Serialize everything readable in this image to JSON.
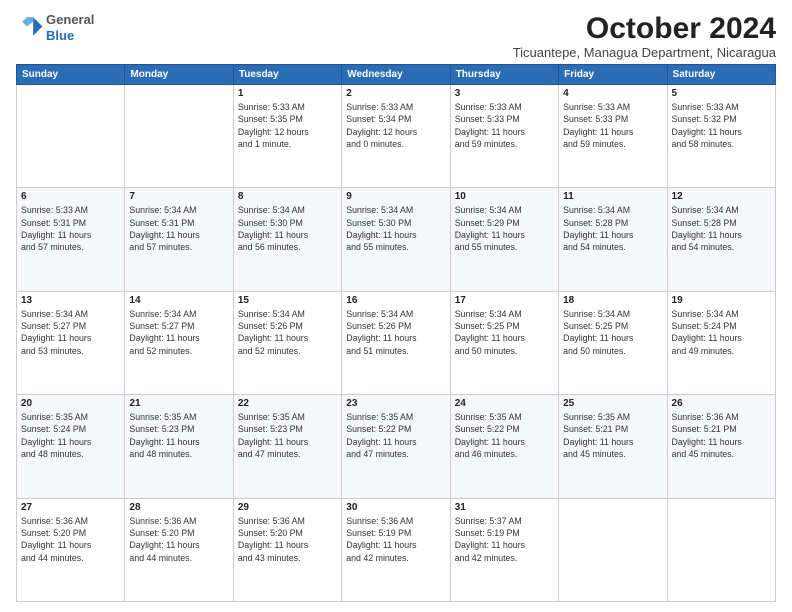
{
  "logo": {
    "general": "General",
    "blue": "Blue"
  },
  "header": {
    "month": "October 2024",
    "location": "Ticuantepe, Managua Department, Nicaragua"
  },
  "days_of_week": [
    "Sunday",
    "Monday",
    "Tuesday",
    "Wednesday",
    "Thursday",
    "Friday",
    "Saturday"
  ],
  "weeks": [
    [
      {
        "day": "",
        "info": ""
      },
      {
        "day": "",
        "info": ""
      },
      {
        "day": "1",
        "info": "Sunrise: 5:33 AM\nSunset: 5:35 PM\nDaylight: 12 hours\nand 1 minute."
      },
      {
        "day": "2",
        "info": "Sunrise: 5:33 AM\nSunset: 5:34 PM\nDaylight: 12 hours\nand 0 minutes."
      },
      {
        "day": "3",
        "info": "Sunrise: 5:33 AM\nSunset: 5:33 PM\nDaylight: 11 hours\nand 59 minutes."
      },
      {
        "day": "4",
        "info": "Sunrise: 5:33 AM\nSunset: 5:33 PM\nDaylight: 11 hours\nand 59 minutes."
      },
      {
        "day": "5",
        "info": "Sunrise: 5:33 AM\nSunset: 5:32 PM\nDaylight: 11 hours\nand 58 minutes."
      }
    ],
    [
      {
        "day": "6",
        "info": "Sunrise: 5:33 AM\nSunset: 5:31 PM\nDaylight: 11 hours\nand 57 minutes."
      },
      {
        "day": "7",
        "info": "Sunrise: 5:34 AM\nSunset: 5:31 PM\nDaylight: 11 hours\nand 57 minutes."
      },
      {
        "day": "8",
        "info": "Sunrise: 5:34 AM\nSunset: 5:30 PM\nDaylight: 11 hours\nand 56 minutes."
      },
      {
        "day": "9",
        "info": "Sunrise: 5:34 AM\nSunset: 5:30 PM\nDaylight: 11 hours\nand 55 minutes."
      },
      {
        "day": "10",
        "info": "Sunrise: 5:34 AM\nSunset: 5:29 PM\nDaylight: 11 hours\nand 55 minutes."
      },
      {
        "day": "11",
        "info": "Sunrise: 5:34 AM\nSunset: 5:28 PM\nDaylight: 11 hours\nand 54 minutes."
      },
      {
        "day": "12",
        "info": "Sunrise: 5:34 AM\nSunset: 5:28 PM\nDaylight: 11 hours\nand 54 minutes."
      }
    ],
    [
      {
        "day": "13",
        "info": "Sunrise: 5:34 AM\nSunset: 5:27 PM\nDaylight: 11 hours\nand 53 minutes."
      },
      {
        "day": "14",
        "info": "Sunrise: 5:34 AM\nSunset: 5:27 PM\nDaylight: 11 hours\nand 52 minutes."
      },
      {
        "day": "15",
        "info": "Sunrise: 5:34 AM\nSunset: 5:26 PM\nDaylight: 11 hours\nand 52 minutes."
      },
      {
        "day": "16",
        "info": "Sunrise: 5:34 AM\nSunset: 5:26 PM\nDaylight: 11 hours\nand 51 minutes."
      },
      {
        "day": "17",
        "info": "Sunrise: 5:34 AM\nSunset: 5:25 PM\nDaylight: 11 hours\nand 50 minutes."
      },
      {
        "day": "18",
        "info": "Sunrise: 5:34 AM\nSunset: 5:25 PM\nDaylight: 11 hours\nand 50 minutes."
      },
      {
        "day": "19",
        "info": "Sunrise: 5:34 AM\nSunset: 5:24 PM\nDaylight: 11 hours\nand 49 minutes."
      }
    ],
    [
      {
        "day": "20",
        "info": "Sunrise: 5:35 AM\nSunset: 5:24 PM\nDaylight: 11 hours\nand 48 minutes."
      },
      {
        "day": "21",
        "info": "Sunrise: 5:35 AM\nSunset: 5:23 PM\nDaylight: 11 hours\nand 48 minutes."
      },
      {
        "day": "22",
        "info": "Sunrise: 5:35 AM\nSunset: 5:23 PM\nDaylight: 11 hours\nand 47 minutes."
      },
      {
        "day": "23",
        "info": "Sunrise: 5:35 AM\nSunset: 5:22 PM\nDaylight: 11 hours\nand 47 minutes."
      },
      {
        "day": "24",
        "info": "Sunrise: 5:35 AM\nSunset: 5:22 PM\nDaylight: 11 hours\nand 46 minutes."
      },
      {
        "day": "25",
        "info": "Sunrise: 5:35 AM\nSunset: 5:21 PM\nDaylight: 11 hours\nand 45 minutes."
      },
      {
        "day": "26",
        "info": "Sunrise: 5:36 AM\nSunset: 5:21 PM\nDaylight: 11 hours\nand 45 minutes."
      }
    ],
    [
      {
        "day": "27",
        "info": "Sunrise: 5:36 AM\nSunset: 5:20 PM\nDaylight: 11 hours\nand 44 minutes."
      },
      {
        "day": "28",
        "info": "Sunrise: 5:36 AM\nSunset: 5:20 PM\nDaylight: 11 hours\nand 44 minutes."
      },
      {
        "day": "29",
        "info": "Sunrise: 5:36 AM\nSunset: 5:20 PM\nDaylight: 11 hours\nand 43 minutes."
      },
      {
        "day": "30",
        "info": "Sunrise: 5:36 AM\nSunset: 5:19 PM\nDaylight: 11 hours\nand 42 minutes."
      },
      {
        "day": "31",
        "info": "Sunrise: 5:37 AM\nSunset: 5:19 PM\nDaylight: 11 hours\nand 42 minutes."
      },
      {
        "day": "",
        "info": ""
      },
      {
        "day": "",
        "info": ""
      }
    ]
  ]
}
